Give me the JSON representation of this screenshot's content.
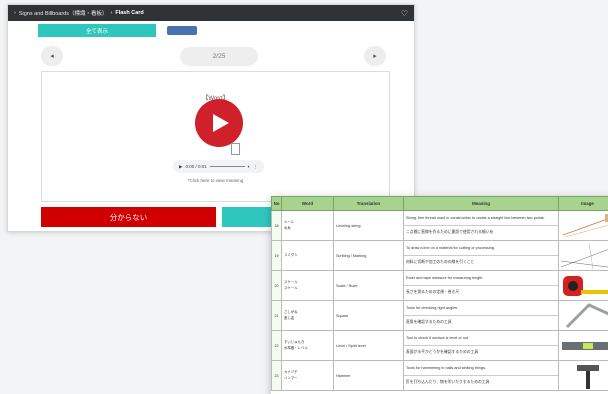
{
  "app": {
    "breadcrumb_prefix": "›",
    "breadcrumb_category": "Signs and Billboards（標識・看板）",
    "breadcrumb_sep": "›",
    "title": "Flash Card",
    "show_all": "全て表示",
    "prev": "◂",
    "next": "▸",
    "page_indicator": "2/25",
    "word_label": "【Word】",
    "audio_time": "0:00 / 0:01",
    "hint": "*Click here to view meaning",
    "dont_know_label": "分からない"
  },
  "table": {
    "headers": [
      "No",
      "Word",
      "Translation",
      "Meaning",
      "Image"
    ],
    "rows": [
      {
        "no": "18",
        "word_ruby": "ルール",
        "word": "水糸",
        "translation": "Leveling string",
        "meaning_en": "String, fine thread used in construction to create a straight line between two points.",
        "meaning_ja": "二点間に直線を作るために建設で使用される細い糸",
        "image": "string-line"
      },
      {
        "no": "19",
        "word_ruby": "",
        "word": "スミダシ",
        "translation": "Scribing / Marking",
        "meaning_en": "To draw a line on a material for cutting or processing.",
        "meaning_ja": "材料に切断や加工のための線を引くこと",
        "image": "marking-lines"
      },
      {
        "no": "20",
        "word_ruby": "スケール",
        "word": "スケール",
        "translation": "Scale / Ruler",
        "meaning_en": "Ruler and tape measure for measuring length.",
        "meaning_ja": "長さを測るための定規・巻き尺",
        "image": "tape-measure"
      },
      {
        "no": "21",
        "word_ruby": "さしがね",
        "word": "差し金",
        "translation": "Square",
        "meaning_en": "Tools for checking right angles.",
        "meaning_ja": "直角を確認するための工具",
        "image": "carpenter-square"
      },
      {
        "no": "22",
        "word_ruby": "すいじゅんき",
        "word": "水準器・レベル",
        "translation": "Level / Spirit level",
        "meaning_en": "Tool to check if surface is level or not.",
        "meaning_ja": "表面が水平かどうかを確認するための工具",
        "image": "spirit-level"
      },
      {
        "no": "23",
        "word_ruby": "カナヅチ",
        "word": "ハンマー",
        "translation": "Hammer",
        "meaning_en": "Tools for hammering in nails and striking things.",
        "meaning_ja": "釘を打ち込んだり、物を叩いたりするための工具",
        "image": "hammer"
      }
    ]
  },
  "colors": {
    "app_bar": "#2f3336",
    "accent_teal": "#2fc7bd",
    "play_red": "#d0202b",
    "dont_know_red": "#d00000",
    "table_header_green": "#a7d38e"
  },
  "icons": {
    "heart": "heart-icon",
    "play": "play-icon"
  }
}
